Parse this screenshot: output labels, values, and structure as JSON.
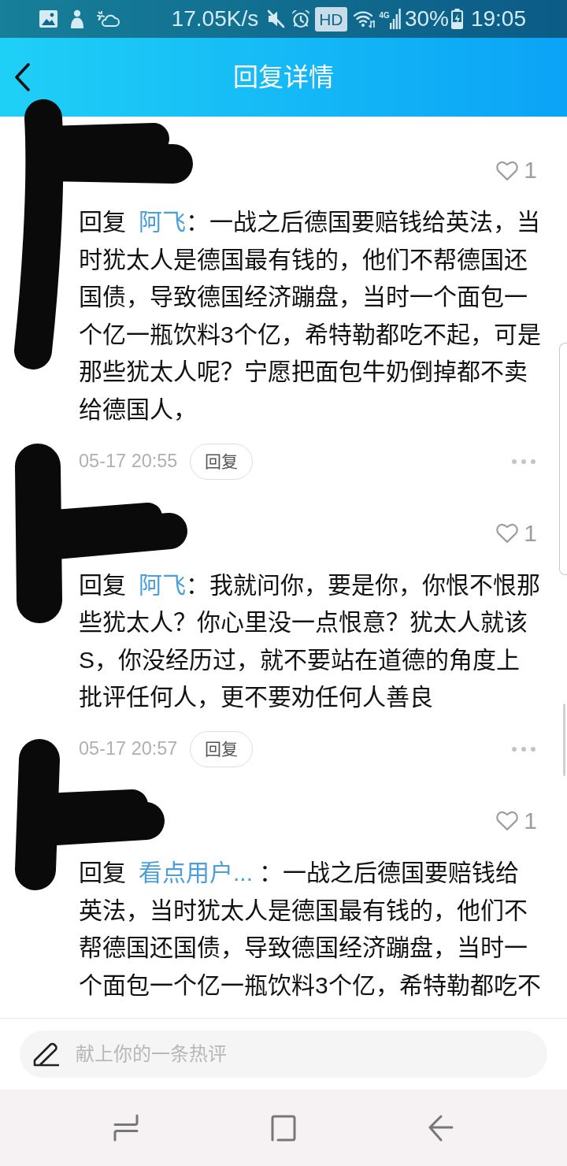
{
  "status_bar": {
    "network_speed": "17.05K/s",
    "hd": "HD",
    "network_type": "4G",
    "battery": "30%",
    "time": "19:05"
  },
  "header": {
    "title": "回复详情"
  },
  "comments": [
    {
      "redacted": true,
      "liked": false,
      "likes": "1",
      "reply_label": "回复",
      "reply_to": "阿飞",
      "text": "：一战之后德国要赔钱给英法，当时犹太人是德国最有钱的，他们不帮德国还国债，导致德国经济蹦盘，当时一个面包一个亿一瓶饮料3个亿，希特勒都吃不起，可是那些犹太人呢？宁愿把面包牛奶倒掉都不卖给德国人，",
      "time": "05-17 20:55",
      "reply_button": "回复"
    },
    {
      "redacted": true,
      "liked": false,
      "likes": "1",
      "reply_label": "回复",
      "reply_to": "阿飞",
      "text": "：我就问你，要是你，你恨不恨那些犹太人？你心里没一点恨意？犹太人就该S，你没经历过，就不要站在道德的角度上批评任何人，更不要劝任何人善良",
      "time": "05-17 20:57",
      "reply_button": "回复"
    },
    {
      "redacted": true,
      "liked": false,
      "likes": "1",
      "reply_label": "回复",
      "reply_to": "看点用户...",
      "text": " ：一战之后德国要赔钱给英法，当时犹太人是德国最有钱的，他们不帮德国还国债，导致德国经济蹦盘，当时一个面包一个亿一瓶饮料3个亿，希特勒都吃不"
    }
  ],
  "comment_input": {
    "placeholder": "献上你的一条热评"
  }
}
